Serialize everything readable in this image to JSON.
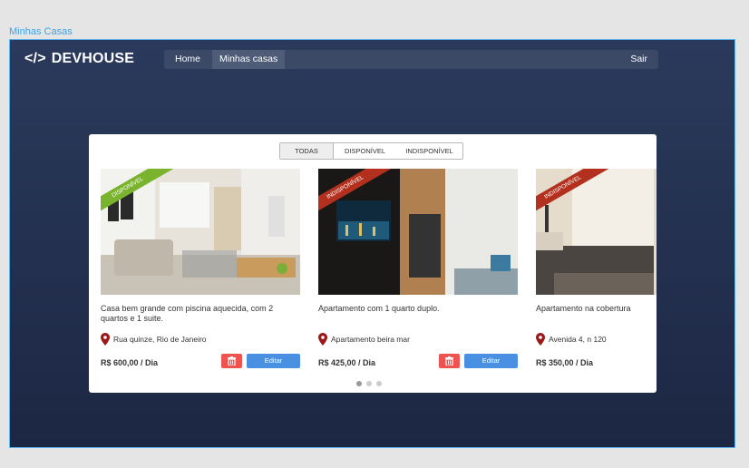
{
  "frame_label": "Minhas Casas",
  "logo": {
    "code": "</>",
    "name": "DEVHOUSE"
  },
  "nav": {
    "home": "Home",
    "mine": "Minhas casas",
    "exit": "Sair"
  },
  "tabs": [
    "TODAS",
    "DISPONÍVEL",
    "INDISPONÍVEL"
  ],
  "listings": [
    {
      "status": "DISPONÍVEL",
      "status_color": "#7ab32e",
      "description": "Casa bem grande com piscina aquecida, com 2 quartos e 1 suite.",
      "address": "Rua quinze, Rio de Janeiro",
      "price": "R$ 600,00 / Dia",
      "edit": "Editar"
    },
    {
      "status": "INDISPONÍVEL",
      "status_color": "#b3301f",
      "description": "Apartamento com 1 quarto duplo.",
      "address": "Apartamento beira mar",
      "price": "R$ 425,00 / Dia",
      "edit": "Editar"
    },
    {
      "status": "INDISPONÍVEL",
      "status_color": "#b3301f",
      "description": "Apartamento na cobertura",
      "address": "Avenida 4, n 120",
      "price": "R$ 350,00 / Dia"
    }
  ],
  "carousel": {
    "pages": 3,
    "active": 1
  },
  "colors": {
    "accent": "#4a90e2",
    "danger": "#ef5350",
    "pin": "#9b1b1b"
  }
}
